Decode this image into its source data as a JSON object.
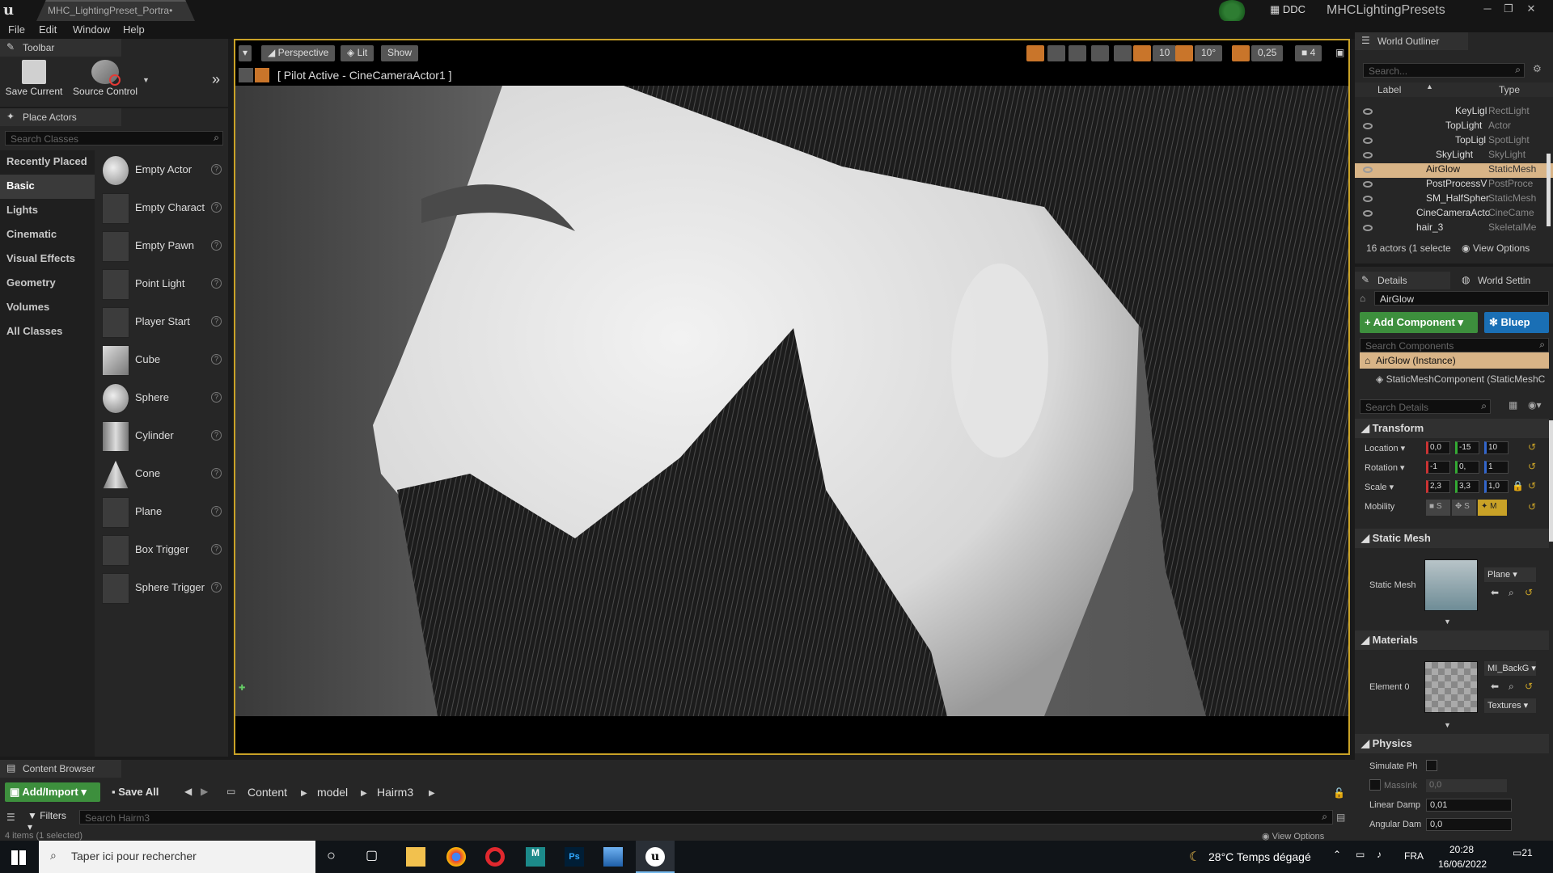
{
  "window": {
    "doc_tab": "MHC_LightingPreset_Portra•",
    "project": "MHCLightingPresets",
    "ddc": "DDC",
    "controls": [
      "─",
      "❐",
      "✕"
    ]
  },
  "menu": [
    "File",
    "Edit",
    "Window",
    "Help"
  ],
  "toolbar": {
    "tab": "Toolbar",
    "save_label": "Save Current",
    "source_label": "Source Control"
  },
  "place_actors": {
    "tab": "Place Actors",
    "search_placeholder": "Search Classes",
    "categories": [
      "Recently Placed",
      "Basic",
      "Lights",
      "Cinematic",
      "Visual Effects",
      "Geometry",
      "Volumes",
      "All Classes"
    ],
    "selected_category": "Basic",
    "actors": [
      "Empty Actor",
      "Empty Charact",
      "Empty Pawn",
      "Point Light",
      "Player Start",
      "Cube",
      "Sphere",
      "Cylinder",
      "Cone",
      "Plane",
      "Box Trigger",
      "Sphere Trigger"
    ]
  },
  "viewport": {
    "perspective": "Perspective",
    "lit": "Lit",
    "show": "Show",
    "pilot": "[ Pilot Active - CineCameraActor1 ]",
    "grid": "10",
    "rot": "10°",
    "scale": "0,25",
    "cam_speed": "4"
  },
  "outliner": {
    "tab": "World Outliner",
    "search_placeholder": "Search...",
    "col_label": "Label",
    "col_type": "Type",
    "rows": [
      {
        "label": "KeyLigl",
        "type": "RectLight",
        "indent": 3
      },
      {
        "label": "TopLight",
        "type": "Actor",
        "indent": 2
      },
      {
        "label": "TopLigl",
        "type": "SpotLight",
        "indent": 3
      },
      {
        "label": "SkyLight",
        "type": "SkyLight",
        "indent": 1
      },
      {
        "label": "AirGlow",
        "type": "StaticMesh",
        "indent": 1,
        "selected": true
      },
      {
        "label": "PostProcessV",
        "type": "PostProce",
        "indent": 1
      },
      {
        "label": "SM_HalfSpher",
        "type": "StaticMesh",
        "indent": 1
      },
      {
        "label": "CineCameraActo",
        "type": "CineCame",
        "indent": 0
      },
      {
        "label": "hair_3",
        "type": "SkeletalMe",
        "indent": 0
      }
    ],
    "status": "16 actors (1 selecte",
    "view_options": "View Options"
  },
  "details": {
    "tab": "Details",
    "tab2": "World Settin",
    "name_value": "AirGlow",
    "add_component": "+ Add Component",
    "blueprint": "Bluep",
    "search_components": "Search Components",
    "instance": "AirGlow (Instance)",
    "component": "StaticMeshComponent (StaticMeshC",
    "search_details": "Search Details",
    "transform_header": "Transform",
    "location_label": "Location",
    "rotation_label": "Rotation",
    "scale_label": "Scale",
    "mobility_label": "Mobility",
    "location": [
      "0,0",
      "-15",
      "10"
    ],
    "rotation": [
      "-1",
      "0,",
      "1"
    ],
    "scale": [
      "2,3",
      "3,3",
      "1,0"
    ],
    "mobility_opts": [
      "S",
      "S",
      "M"
    ],
    "static_mesh_header": "Static Mesh",
    "static_mesh_label": "Static Mesh",
    "static_mesh_value": "Plane",
    "materials_header": "Materials",
    "element0_label": "Element 0",
    "element0_value": "MI_BackG",
    "textures": "Textures",
    "physics_header": "Physics",
    "simulate": "Simulate Ph",
    "mass": "MassInk",
    "mass_value": "0,0",
    "linear_damp": "Linear Damp",
    "linear_damp_value": "0,01",
    "angular_damp": "Angular Dam",
    "angular_damp_value": "0,0"
  },
  "content_browser": {
    "tab": "Content Browser",
    "add_import": "Add/Import",
    "save_all": "Save All",
    "breadcrumb": [
      "Content",
      "model",
      "Hairm3"
    ],
    "filters": "Filters",
    "search_placeholder": "Search Hairm3",
    "status": "4 items (1 selected)",
    "view_options": "View Options"
  },
  "taskbar": {
    "search_placeholder": "Taper ici pour rechercher",
    "weather": "28°C  Temps dégagé",
    "lang": "FRA",
    "time": "20:28",
    "date": "16/06/2022",
    "notif": "21"
  },
  "colors": {
    "accent_yellow": "#c9a227",
    "add_green": "#3d8f3d",
    "blue_button": "#1a6fb5",
    "selected_orange": "#d8b487"
  }
}
